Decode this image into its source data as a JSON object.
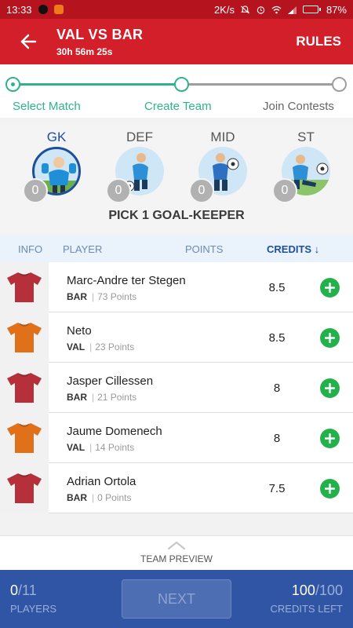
{
  "status_bar": {
    "time": "13:33",
    "network_speed": "2K/s",
    "battery_percent": "87%",
    "battery_level": 0.87
  },
  "app_bar": {
    "title": "VAL VS BAR",
    "timer": "30h 56m 25s",
    "rules_label": "RULES",
    "back_icon": "arrow-left-icon"
  },
  "stepper": {
    "steps": [
      {
        "label": "Select Match",
        "state": "done"
      },
      {
        "label": "Create Team",
        "state": "current"
      },
      {
        "label": "Join Contests",
        "state": "pending"
      }
    ],
    "colors": {
      "active": "#2fb38a",
      "inactive": "#9e9e9e"
    }
  },
  "positions": [
    {
      "label": "GK",
      "count": "0",
      "active": true
    },
    {
      "label": "DEF",
      "count": "0",
      "active": false
    },
    {
      "label": "MID",
      "count": "0",
      "active": false
    },
    {
      "label": "ST",
      "count": "0",
      "active": false
    }
  ],
  "pick_title": "PICK 1 GOAL-KEEPER",
  "table_header": {
    "info": "INFO",
    "player": "PLAYER",
    "points": "POINTS",
    "credits": "CREDITS ↓"
  },
  "players": [
    {
      "name": "Marc-Andre ter Stegen",
      "team": "BAR",
      "points": "73 Points",
      "credits": "8.5",
      "jersey_color": "#b5303a"
    },
    {
      "name": "Neto",
      "team": "VAL",
      "points": "23 Points",
      "credits": "8.5",
      "jersey_color": "#e0701a"
    },
    {
      "name": "Jasper Cillessen",
      "team": "BAR",
      "points": "21 Points",
      "credits": "8",
      "jersey_color": "#b5303a"
    },
    {
      "name": "Jaume Domenech",
      "team": "VAL",
      "points": "14 Points",
      "credits": "8",
      "jersey_color": "#e0701a"
    },
    {
      "name": "Adrian Ortola",
      "team": "BAR",
      "points": "0 Points",
      "credits": "7.5",
      "jersey_color": "#b5303a"
    }
  ],
  "team_preview_label": "TEAM PREVIEW",
  "bottom_bar": {
    "players_selected": "0",
    "players_total": "/11",
    "players_label": "PLAYERS",
    "next_label": "NEXT",
    "credits_left": "100",
    "credits_total": "/100",
    "credits_label": "CREDITS LEFT"
  },
  "colors": {
    "brand_red": "#d21f2a",
    "status_red": "#b5141e",
    "brand_blue": "#2f55a4",
    "add_green": "#23b14d",
    "gk_blue": "#1d4f9c"
  }
}
